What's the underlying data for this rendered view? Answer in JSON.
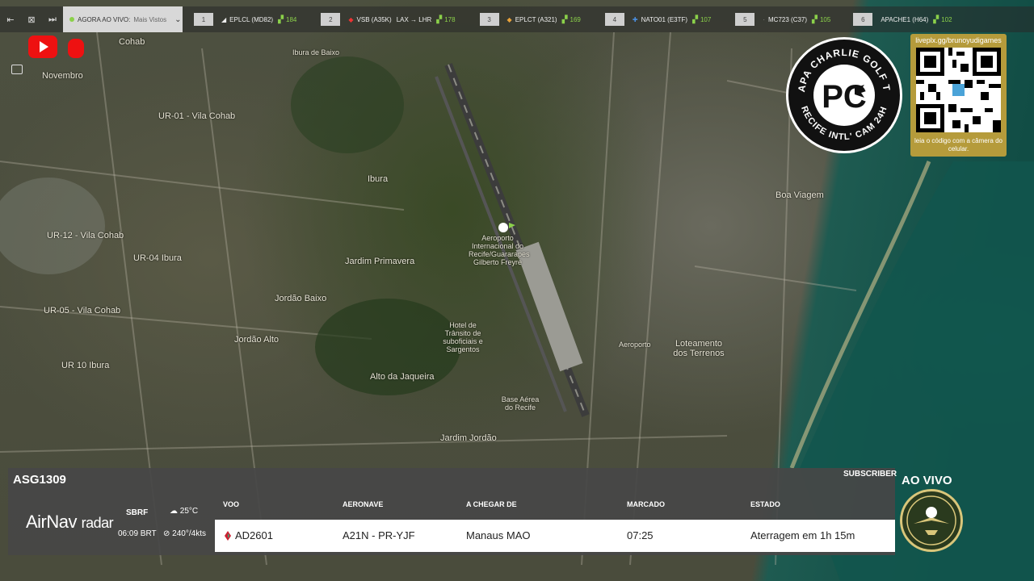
{
  "topbar": {
    "now_live_label": "AGORA AO VIVO:",
    "now_live_value": "Mais Vistos",
    "slots": [
      {
        "num": "1",
        "code": "EPLCL (MD82)",
        "route": "",
        "signal": "184"
      },
      {
        "num": "2",
        "code": "VSB (A35K)",
        "route": "LAX → LHR",
        "signal": "178"
      },
      {
        "num": "3",
        "code": "EPLCT (A321)",
        "route": "",
        "signal": "169"
      },
      {
        "num": "4",
        "code": "NATO01 (E3TF)",
        "route": "",
        "signal": "107"
      },
      {
        "num": "5",
        "code": "MC723 (C37)",
        "route": "",
        "signal": "105"
      },
      {
        "num": "6",
        "code": "APACHE1 (H64)",
        "route": "",
        "signal": "102"
      }
    ]
  },
  "map_labels": [
    "Ibura de Baixo",
    "Jardim Primavera",
    "Ibura",
    "Jordão Baixo",
    "Jordão Alto",
    "Alto da Jaqueira",
    "Jardim Jordão",
    "Boa Viagem",
    "Loteamento dos Terrenos",
    "Aeroporto Internacional do Recife/Guararapes Gilberto Freyre",
    "Hotel de Trânsito de suboficiais e Sargentos",
    "Base Aérea do Recife",
    "UR-01 - Vila Cohab",
    "UR-04 Ibura",
    "UR-05 - Vila Cohab",
    "UR-12 - Vila Cohab",
    "UR 10 Ibura",
    "Novembro",
    "Cohab",
    "Aeroporto"
  ],
  "logo": {
    "top_text": "PAPA CHARLIE GOLF TV",
    "bottom_text": "RECIFE INTL' CAM 24H",
    "mark": "PC"
  },
  "qr": {
    "url": "liveplx.gg/brunoyudigames",
    "caption": "leia o código com a câmera do celular."
  },
  "panel": {
    "callsign": "ASG1309",
    "subscriber": "SUBSCRIBER",
    "brand": "AirNav",
    "brand_sub": "radar",
    "weather": {
      "icao": "SBRF",
      "temp": "25°C",
      "time": "06:09 BRT",
      "wind": "240°/4kts"
    },
    "headers": {
      "flight": "VOO",
      "aircraft": "AERONAVE",
      "from": "A CHEGAR DE",
      "scheduled": "MARCADO",
      "status": "ESTADO"
    },
    "row": {
      "flight": "AD2601",
      "aircraft": "A21N - PR-YJF",
      "from": "Manaus MAO",
      "scheduled": "07:25",
      "status": "Aterragem em 1h 15m"
    }
  },
  "live_label": "AO VIVO",
  "colors": {
    "signal": "#8bd14a",
    "qr_box": "#b59b3b",
    "youtube": "#ee1111"
  }
}
